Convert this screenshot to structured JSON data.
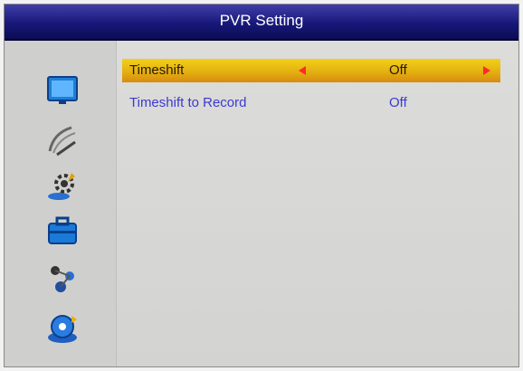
{
  "title": "PVR Setting",
  "sidebar": {
    "icons": [
      {
        "name": "monitor-icon"
      },
      {
        "name": "satellite-dish-icon"
      },
      {
        "name": "settings-gear-icon"
      },
      {
        "name": "toolbox-icon"
      },
      {
        "name": "network-users-icon"
      },
      {
        "name": "media-disc-icon"
      }
    ]
  },
  "menu": {
    "items": [
      {
        "label": "Timeshift",
        "value": "Off",
        "selected": true
      },
      {
        "label": "Timeshift to Record",
        "value": "Off",
        "selected": false
      }
    ]
  },
  "colors": {
    "title_bar": "#18187a",
    "highlight": "#e4b10f",
    "item_text": "#3a3ad2",
    "arrow": "#ff2a2a"
  }
}
